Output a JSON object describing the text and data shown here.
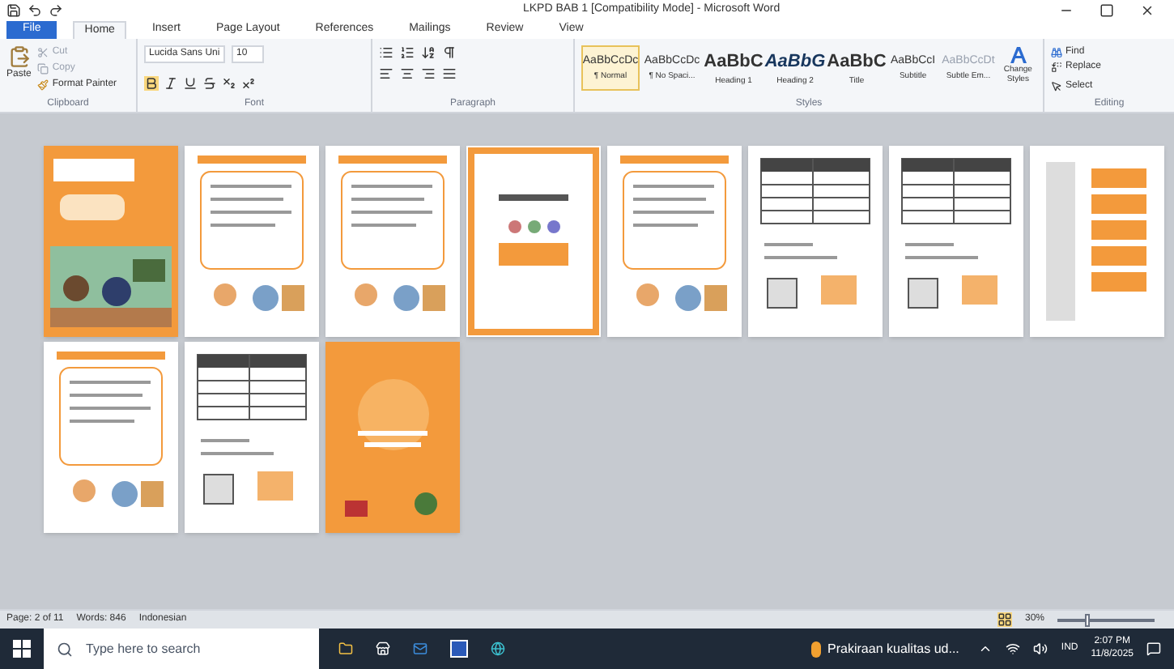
{
  "window": {
    "title": "LKPD BAB 1 [Compatibility Mode] - Microsoft Word"
  },
  "tabs": [
    {
      "label": "File",
      "kind": "file",
      "selected": false
    },
    {
      "label": "Home",
      "kind": "tab",
      "selected": true
    },
    {
      "label": "Insert",
      "kind": "tab",
      "selected": false
    },
    {
      "label": "Page Layout",
      "kind": "tab",
      "selected": false
    },
    {
      "label": "References",
      "kind": "tab",
      "selected": false
    },
    {
      "label": "Mailings",
      "kind": "tab",
      "selected": false
    },
    {
      "label": "Review",
      "kind": "tab",
      "selected": false
    },
    {
      "label": "View",
      "kind": "tab",
      "selected": false
    }
  ],
  "clipboard": {
    "paste": "Paste",
    "cut": "Cut",
    "copy": "Copy",
    "format_painter": "Format Painter",
    "label": "Clipboard"
  },
  "font": {
    "name": "Lucida Sans Uni",
    "size": "10",
    "label": "Font"
  },
  "paragraph": {
    "label": "Paragraph"
  },
  "styles": {
    "items": [
      {
        "preview": "AaBbCcDc",
        "name": "¶ Normal",
        "kind": "small",
        "selected": true
      },
      {
        "preview": "AaBbCcDc",
        "name": "¶ No Spaci...",
        "kind": "small",
        "selected": false
      },
      {
        "preview": "AaBbC",
        "name": "Heading 1",
        "kind": "bold",
        "selected": false
      },
      {
        "preview": "AaBbG",
        "name": "Heading 2",
        "kind": "italic",
        "selected": false
      },
      {
        "preview": "AaBbC",
        "name": "Title",
        "kind": "bold",
        "selected": false
      },
      {
        "preview": "AaBbCcI",
        "name": "Subtitle",
        "kind": "small",
        "selected": false
      },
      {
        "preview": "AaBbCcDt",
        "name": "Subtle Em...",
        "kind": "faint",
        "selected": false
      }
    ],
    "change": "Change Styles",
    "label": "Styles"
  },
  "editing": {
    "find": "Find",
    "replace": "Replace",
    "select": "Select",
    "label": "Editing"
  },
  "pages": [
    {
      "kind": "cover"
    },
    {
      "kind": "text"
    },
    {
      "kind": "text"
    },
    {
      "kind": "framed"
    },
    {
      "kind": "text"
    },
    {
      "kind": "table"
    },
    {
      "kind": "table"
    },
    {
      "kind": "column"
    },
    {
      "kind": "text"
    },
    {
      "kind": "table"
    },
    {
      "kind": "closing"
    }
  ],
  "status_bar": {
    "page": "Page: 2 of 11",
    "words": "Words: 846",
    "language": "Indonesian",
    "zoom": "30%",
    "zoom_slider": {
      "level": 0.3
    }
  },
  "taskbar": {
    "search": "Type here to search",
    "app": "Prakiraan kualitas ud...",
    "lang": "IND",
    "time": "2:07 PM",
    "date": "11/8/2025"
  }
}
